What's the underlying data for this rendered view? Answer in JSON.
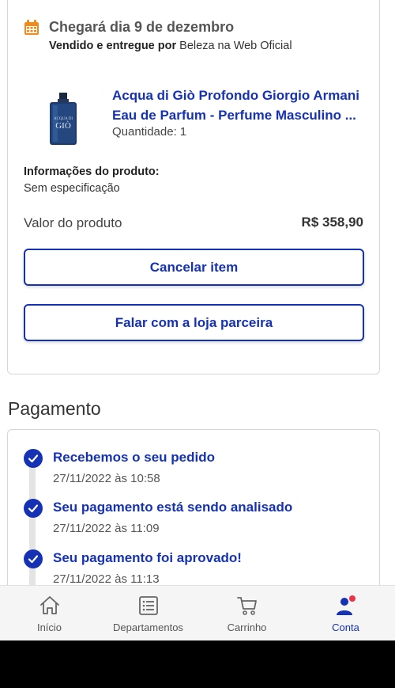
{
  "order": {
    "delivery_title": "Chegará dia 9 de dezembro",
    "seller_prefix": "Vendido e entregue por",
    "seller_name": "Beleza na Web Oficial",
    "product": {
      "name_line1": "Acqua di Giò Profondo Giorgio Armani",
      "name_line2": "Eau de Parfum - Perfume Masculino ...",
      "quantity_label": "Quantidade:",
      "quantity_value": "1"
    },
    "info_label": "Informações do produto:",
    "info_value": "Sem especificação",
    "price_label": "Valor do produto",
    "price_value": "R$ 358,90",
    "cancel_button": "Cancelar item",
    "talk_button": "Falar com a loja parceira"
  },
  "payment": {
    "title": "Pagamento",
    "steps": [
      {
        "title": "Recebemos o seu pedido",
        "date": "27/11/2022 às 10:58"
      },
      {
        "title": "Seu pagamento está sendo analisado",
        "date": "27/11/2022 às 11:09"
      },
      {
        "title": "Seu pagamento foi aprovado!",
        "date": "27/11/2022 às 11:13"
      }
    ]
  },
  "nav": {
    "items": [
      {
        "label": "Início",
        "icon": "home-icon"
      },
      {
        "label": "Departamentos",
        "icon": "list-icon"
      },
      {
        "label": "Carrinho",
        "icon": "cart-icon"
      },
      {
        "label": "Conta",
        "icon": "account-icon",
        "active": true
      }
    ]
  },
  "colors": {
    "accent": "#1632b4",
    "delivery_icon": "#f08a1a",
    "notification_dot": "#e8334a"
  }
}
